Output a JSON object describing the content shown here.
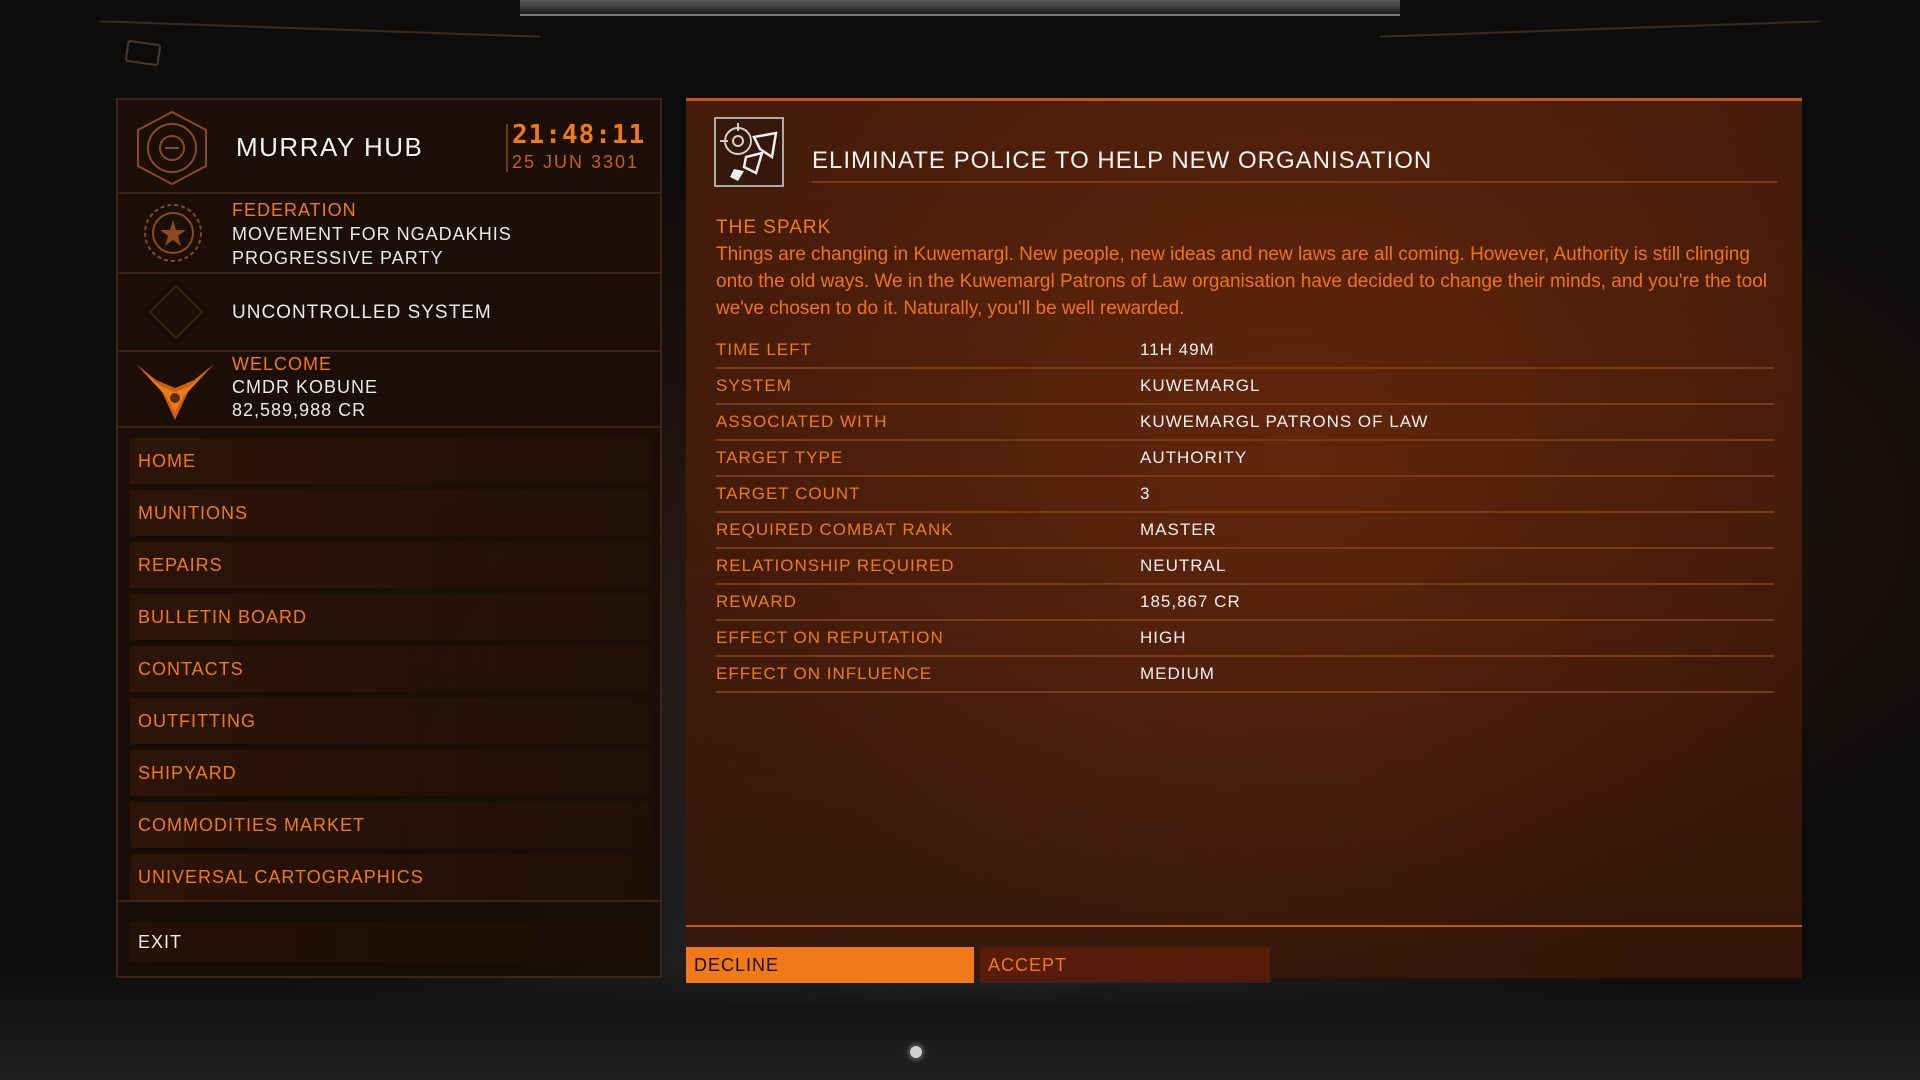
{
  "station": {
    "name": "MURRAY HUB",
    "time": "21:48:11",
    "date": "25 JUN 3301"
  },
  "faction": {
    "superpower": "FEDERATION",
    "name": "MOVEMENT FOR NGADAKHIS PROGRESSIVE PARTY"
  },
  "control": {
    "status": "UNCONTROLLED SYSTEM"
  },
  "welcome": {
    "label": "WELCOME",
    "commander": "CMDR KOBUNE",
    "credits": "82,589,988 CR"
  },
  "menu": {
    "items": [
      {
        "label": "HOME"
      },
      {
        "label": "MUNITIONS"
      },
      {
        "label": "REPAIRS"
      },
      {
        "label": "BULLETIN BOARD"
      },
      {
        "label": "CONTACTS"
      },
      {
        "label": "OUTFITTING"
      },
      {
        "label": "SHIPYARD"
      },
      {
        "label": "COMMODITIES MARKET"
      },
      {
        "label": "UNIVERSAL CARTOGRAPHICS"
      }
    ],
    "exit": "EXIT"
  },
  "mission": {
    "icon": "target-crosshair-shards-icon",
    "title": "ELIMINATE POLICE TO HELP NEW ORGANISATION",
    "flavor_title": "THE SPARK",
    "flavor_text": "Things are changing in Kuwemargl. New people, new ideas and new laws are all coming. However, Authority is still clinging onto the old ways. We in the Kuwemargl Patrons of Law organisation have decided to change their minds, and you're the tool we've chosen to do it.  Naturally, you'll be well rewarded.",
    "details": [
      {
        "label": "TIME LEFT",
        "value": "11H 49M"
      },
      {
        "label": "SYSTEM",
        "value": "KUWEMARGL"
      },
      {
        "label": "ASSOCIATED WITH",
        "value": "KUWEMARGL PATRONS OF LAW"
      },
      {
        "label": "TARGET TYPE",
        "value": "AUTHORITY"
      },
      {
        "label": "TARGET COUNT",
        "value": "3"
      },
      {
        "label": "REQUIRED COMBAT RANK",
        "value": "MASTER"
      },
      {
        "label": "RELATIONSHIP REQUIRED",
        "value": "NEUTRAL"
      },
      {
        "label": "REWARD",
        "value": "185,867 CR"
      },
      {
        "label": "EFFECT ON REPUTATION",
        "value": "HIGH"
      },
      {
        "label": "EFFECT ON INFLUENCE",
        "value": "MEDIUM"
      }
    ],
    "decline": "DECLINE",
    "accept": "ACCEPT"
  },
  "colors": {
    "accent": "#f07a17",
    "text_light": "#f0f0f0",
    "panel_bg": "#1e0f06"
  }
}
